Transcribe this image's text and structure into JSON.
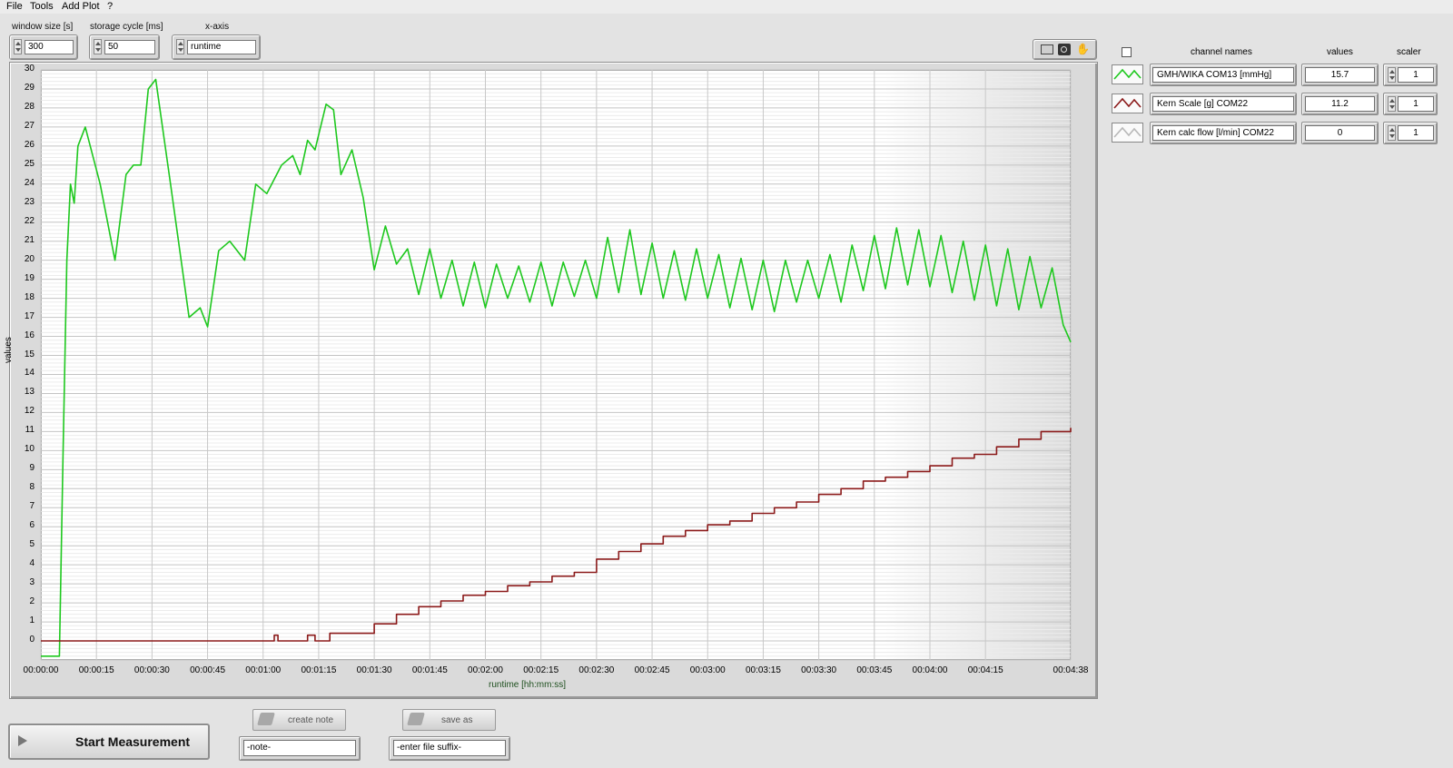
{
  "menu": {
    "items": [
      "File",
      "Tools",
      "Add Plot",
      "?"
    ]
  },
  "controls": {
    "window_size": {
      "label": "window size [s]",
      "value": "300"
    },
    "storage_cycle": {
      "label": "storage cycle [ms]",
      "value": "50"
    },
    "x_axis": {
      "label": "x-axis",
      "value": "runtime"
    }
  },
  "channels": {
    "header_names": "channel names",
    "header_values": "values",
    "header_scaler": "scaler",
    "items": [
      {
        "name": "GMH/WIKA COM13 [mmHg]",
        "value": "15.7",
        "scaler": "1",
        "color": "#1ec81e"
      },
      {
        "name": "Kern Scale [g] COM22",
        "value": "11.2",
        "scaler": "1",
        "color": "#8b1a1a"
      },
      {
        "name": "Kern calc flow [l/min] COM22",
        "value": "0",
        "scaler": "1",
        "color": "#b8b8b8"
      }
    ]
  },
  "buttons": {
    "start": "Start Measurement",
    "create_note": "create note",
    "save_as": "save as",
    "note_placeholder": "-note-",
    "file_suffix_placeholder": "-enter file suffix-"
  },
  "chart_data": {
    "type": "line",
    "xlabel": "runtime [hh:mm:ss]",
    "ylabel": "values",
    "ylim": [
      -1,
      30
    ],
    "xlim": [
      "00:00:00",
      "00:04:38"
    ],
    "grid": true,
    "x_ticks": [
      "00:00:00",
      "00:00:15",
      "00:00:30",
      "00:00:45",
      "00:01:00",
      "00:01:15",
      "00:01:30",
      "00:01:45",
      "00:02:00",
      "00:02:15",
      "00:02:30",
      "00:02:45",
      "00:03:00",
      "00:03:15",
      "00:03:30",
      "00:03:45",
      "00:04:00",
      "00:04:15",
      "00:04:38"
    ],
    "y_ticks": [
      0,
      1,
      2,
      3,
      4,
      5,
      6,
      7,
      8,
      9,
      10,
      11,
      12,
      13,
      14,
      15,
      16,
      17,
      18,
      19,
      20,
      21,
      22,
      23,
      24,
      25,
      26,
      27,
      28,
      29,
      30
    ],
    "series": [
      {
        "name": "GMH/WIKA COM13 [mmHg]",
        "color": "#1ec81e",
        "x": [
          "00:00:00",
          "00:00:05",
          "00:00:06",
          "00:00:07",
          "00:00:08",
          "00:00:09",
          "00:00:10",
          "00:00:12",
          "00:00:16",
          "00:00:20",
          "00:00:23",
          "00:00:25",
          "00:00:27",
          "00:00:29",
          "00:00:31",
          "00:00:35",
          "00:00:40",
          "00:00:43",
          "00:00:45",
          "00:00:48",
          "00:00:51",
          "00:00:55",
          "00:00:58",
          "00:01:01",
          "00:01:05",
          "00:01:08",
          "00:01:10",
          "00:01:12",
          "00:01:14",
          "00:01:17",
          "00:01:19",
          "00:01:21",
          "00:01:24",
          "00:01:27",
          "00:01:30",
          "00:01:33",
          "00:01:36",
          "00:01:39",
          "00:01:42",
          "00:01:45",
          "00:01:48",
          "00:01:51",
          "00:01:54",
          "00:01:57",
          "00:02:00",
          "00:02:03",
          "00:02:06",
          "00:02:09",
          "00:02:12",
          "00:02:15",
          "00:02:18",
          "00:02:21",
          "00:02:24",
          "00:02:27",
          "00:02:30",
          "00:02:33",
          "00:02:36",
          "00:02:39",
          "00:02:42",
          "00:02:45",
          "00:02:48",
          "00:02:51",
          "00:02:54",
          "00:02:57",
          "00:03:00",
          "00:03:03",
          "00:03:06",
          "00:03:09",
          "00:03:12",
          "00:03:15",
          "00:03:18",
          "00:03:21",
          "00:03:24",
          "00:03:27",
          "00:03:30",
          "00:03:33",
          "00:03:36",
          "00:03:39",
          "00:03:42",
          "00:03:45",
          "00:03:48",
          "00:03:51",
          "00:03:54",
          "00:03:57",
          "00:04:00",
          "00:04:03",
          "00:04:06",
          "00:04:09",
          "00:04:12",
          "00:04:15",
          "00:04:18",
          "00:04:21",
          "00:04:24",
          "00:04:27",
          "00:04:30",
          "00:04:33",
          "00:04:36",
          "00:04:38"
        ],
        "values": [
          -0.8,
          -0.8,
          10,
          20,
          24,
          23,
          26,
          27,
          24,
          20,
          24.5,
          25,
          25,
          29,
          29.5,
          24,
          17,
          17.5,
          16.5,
          20.5,
          21,
          20,
          24,
          23.5,
          25,
          25.5,
          24.5,
          26.3,
          25.8,
          28.2,
          27.9,
          24.5,
          25.8,
          23.3,
          19.5,
          21.8,
          19.8,
          20.6,
          18.2,
          20.6,
          18,
          20,
          17.6,
          19.9,
          17.5,
          19.8,
          18,
          19.7,
          17.8,
          19.9,
          17.6,
          19.9,
          18.1,
          20,
          18,
          21.2,
          18.3,
          21.6,
          18.2,
          20.9,
          18,
          20.5,
          17.9,
          20.6,
          18,
          20.3,
          17.5,
          20.1,
          17.4,
          20,
          17.3,
          20,
          17.8,
          20,
          18,
          20.3,
          17.8,
          20.8,
          18.4,
          21.3,
          18.5,
          21.7,
          18.7,
          21.6,
          18.6,
          21.3,
          18.3,
          21,
          17.9,
          20.8,
          17.6,
          20.6,
          17.4,
          20.2,
          17.5,
          19.6,
          16.6,
          15.7
        ]
      },
      {
        "name": "Kern Scale [g] COM22",
        "color": "#8b1a1a",
        "x": [
          "00:00:00",
          "00:01:00",
          "00:01:03",
          "00:01:04",
          "00:01:12",
          "00:01:14",
          "00:01:18",
          "00:01:24",
          "00:01:30",
          "00:01:36",
          "00:01:42",
          "00:01:48",
          "00:01:54",
          "00:02:00",
          "00:02:06",
          "00:02:12",
          "00:02:18",
          "00:02:24",
          "00:02:30",
          "00:02:36",
          "00:02:42",
          "00:02:48",
          "00:02:54",
          "00:03:00",
          "00:03:06",
          "00:03:12",
          "00:03:18",
          "00:03:24",
          "00:03:30",
          "00:03:36",
          "00:03:42",
          "00:03:48",
          "00:03:54",
          "00:04:00",
          "00:04:06",
          "00:04:12",
          "00:04:18",
          "00:04:24",
          "00:04:30",
          "00:04:38"
        ],
        "values": [
          0,
          0,
          0.3,
          0,
          0.3,
          0,
          0.4,
          0.4,
          0.9,
          1.4,
          1.8,
          2.1,
          2.4,
          2.6,
          2.9,
          3.1,
          3.4,
          3.6,
          4.3,
          4.7,
          5.1,
          5.5,
          5.8,
          6.1,
          6.3,
          6.7,
          7.0,
          7.3,
          7.7,
          8.0,
          8.4,
          8.6,
          8.9,
          9.2,
          9.6,
          9.8,
          10.2,
          10.6,
          11.0,
          11.2
        ]
      },
      {
        "name": "Kern calc flow [l/min] COM22",
        "color": "#b8b8b8",
        "x": [],
        "values": []
      }
    ]
  }
}
